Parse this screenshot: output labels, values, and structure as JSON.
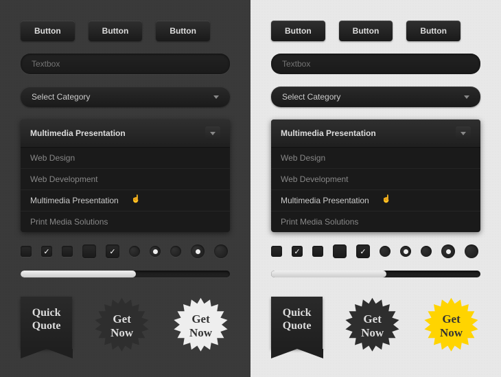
{
  "buttons": [
    "Button",
    "Button",
    "Button"
  ],
  "textbox_placeholder": "Textbox",
  "select_label": "Select Category",
  "dropdown": {
    "header": "Multimedia Presentation",
    "items": [
      "Web Design",
      "Web Development",
      "Multimedia Presentation",
      "Print Media Solutions"
    ],
    "hover_index": 2
  },
  "progress_percent": 55,
  "ribbon": {
    "line1": "Quick",
    "line2": "Quote"
  },
  "starburst": {
    "line1": "Get",
    "line2": "Now"
  },
  "colors": {
    "starburst_dark": "#2e2e2e",
    "starburst_light": "#eeeeee",
    "starburst_yellow": "#ffd400"
  }
}
